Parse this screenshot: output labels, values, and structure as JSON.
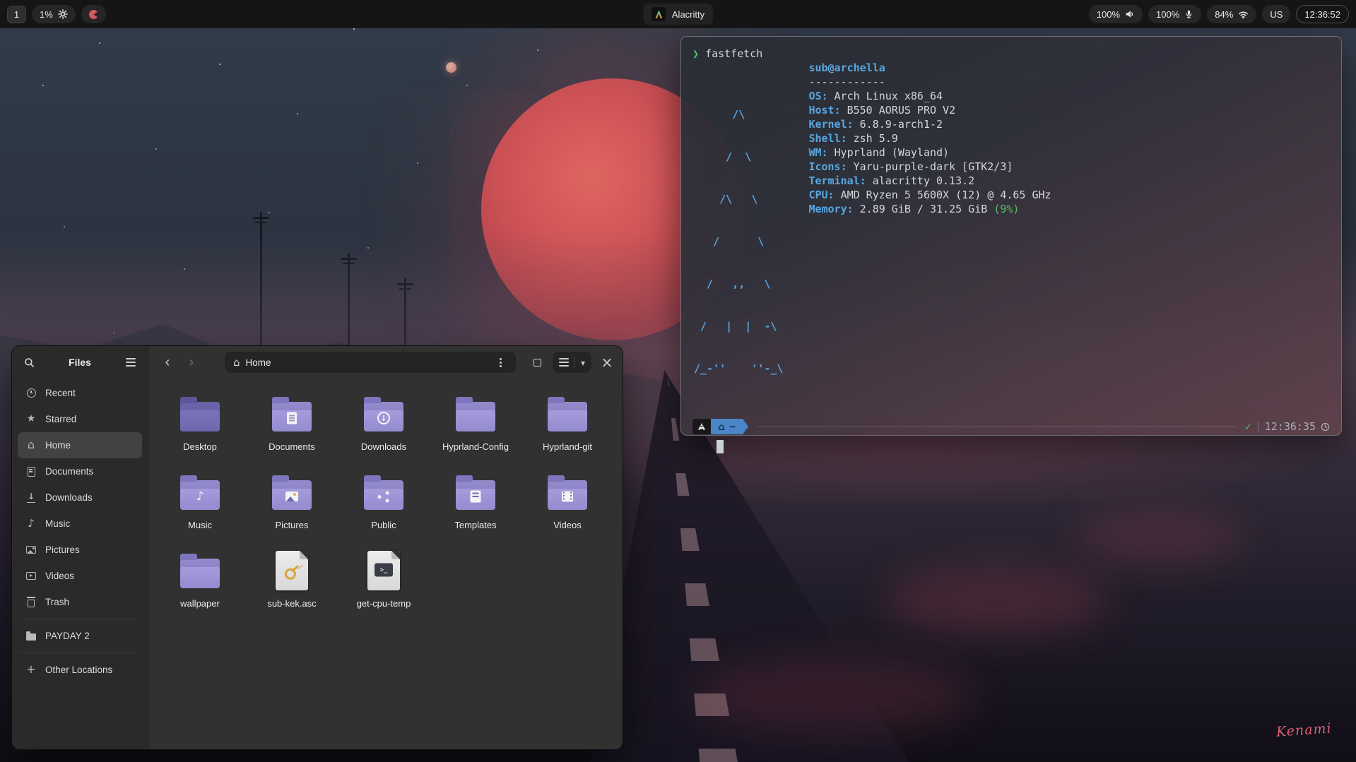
{
  "topbar": {
    "workspace": "1",
    "cpu_percent": "1%",
    "window_title": "Alacritty",
    "volume_percent": "100%",
    "mic_percent": "100%",
    "wifi_percent": "84%",
    "keyboard_layout": "US",
    "clock": "12:36:52"
  },
  "terminal": {
    "prompt_symbol": "❯",
    "command": "fastfetch",
    "logo": [
      "      /\\",
      "     /  \\",
      "    /\\   \\",
      "   /      \\",
      "  /   ,,   \\",
      " /   |  |  -\\",
      "/_-''    ''-_\\"
    ],
    "user_host": "sub@archella",
    "separator": "------------",
    "info": [
      {
        "key": "OS:",
        "value": "Arch Linux x86_64"
      },
      {
        "key": "Host:",
        "value": "B550 AORUS PRO V2"
      },
      {
        "key": "Kernel:",
        "value": "6.8.9-arch1-2"
      },
      {
        "key": "Shell:",
        "value": "zsh 5.9"
      },
      {
        "key": "WM:",
        "value": "Hyprland (Wayland)"
      },
      {
        "key": "Icons:",
        "value": "Yaru-purple-dark [GTK2/3]"
      },
      {
        "key": "Terminal:",
        "value": "alacritty 0.13.2"
      },
      {
        "key": "CPU:",
        "value": "AMD Ryzen 5 5600X (12) @ 4.65 GHz"
      },
      {
        "key": "Memory:",
        "value": "2.89 GiB / 31.25 GiB ",
        "highlight": "(9%)"
      }
    ],
    "powerline": {
      "path": "~",
      "status": "✓",
      "time": "12:36:35"
    }
  },
  "files": {
    "app_title": "Files",
    "breadcrumb": "Home",
    "sidebar": [
      {
        "label": "Recent"
      },
      {
        "label": "Starred"
      },
      {
        "label": "Home"
      },
      {
        "label": "Documents"
      },
      {
        "label": "Downloads"
      },
      {
        "label": "Music"
      },
      {
        "label": "Pictures"
      },
      {
        "label": "Videos"
      },
      {
        "label": "Trash"
      },
      {
        "label": "PAYDAY 2"
      },
      {
        "label": "Other Locations"
      }
    ],
    "items": [
      {
        "label": "Desktop"
      },
      {
        "label": "Documents"
      },
      {
        "label": "Downloads"
      },
      {
        "label": "Hyprland-Config"
      },
      {
        "label": "Hyprland-git"
      },
      {
        "label": "Music"
      },
      {
        "label": "Pictures"
      },
      {
        "label": "Public"
      },
      {
        "label": "Templates"
      },
      {
        "label": "Videos"
      },
      {
        "label": "wallpaper"
      },
      {
        "label": "sub-kek.asc"
      },
      {
        "label": "get-cpu-temp"
      }
    ]
  },
  "wallpaper": {
    "signature": "Kenami"
  }
}
